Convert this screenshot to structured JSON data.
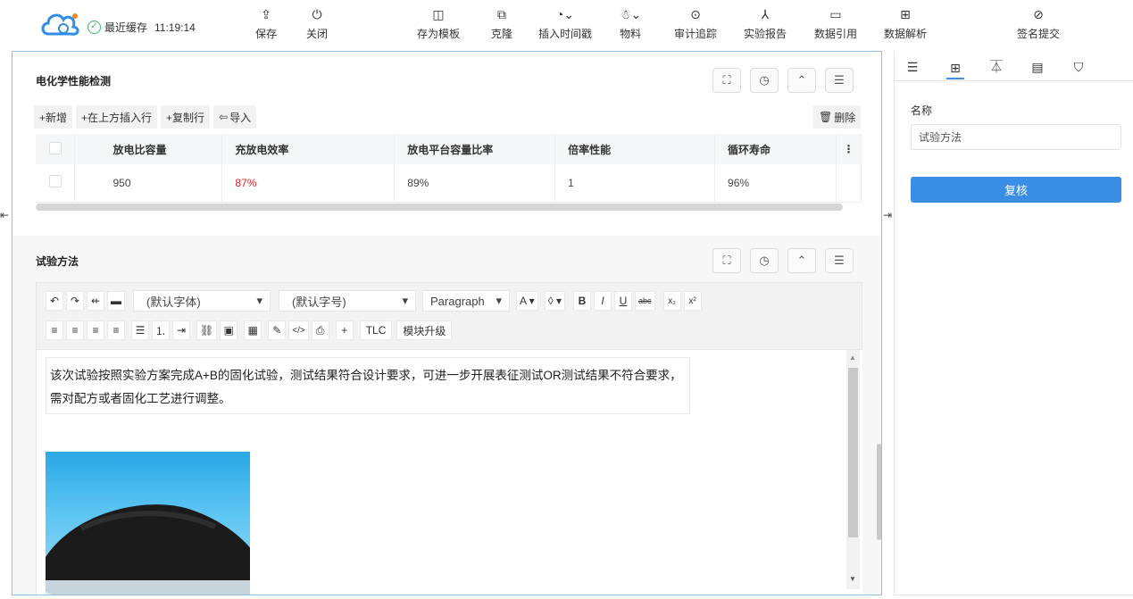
{
  "topbar": {
    "saved_text": "最近缓存",
    "saved_time": "11:19:14",
    "tools": [
      {
        "label": "保存",
        "icon": "save-icon"
      },
      {
        "label": "关闭",
        "icon": "power-icon"
      },
      {
        "label": "存为模板",
        "icon": "template-icon"
      },
      {
        "label": "克隆",
        "icon": "clone-icon"
      },
      {
        "label": "插入时间戳",
        "icon": "clock-icon"
      },
      {
        "label": "物料",
        "icon": "material-icon"
      },
      {
        "label": "审计追踪",
        "icon": "audit-icon"
      },
      {
        "label": "实验报告",
        "icon": "report-icon"
      },
      {
        "label": "数据引用",
        "icon": "data-ref-icon"
      },
      {
        "label": "数据解析",
        "icon": "data-parse-icon"
      },
      {
        "label": "签名提交",
        "icon": "sign-icon"
      }
    ]
  },
  "section1": {
    "title": "电化学性能检测",
    "buttons": {
      "add": "+新增",
      "insert_above": "+在上方插入行",
      "copy_row": "+复制行",
      "import": "导入",
      "delete": "删除"
    },
    "columns": [
      "放电比容量",
      "充放电效率",
      "放电平台容量比率",
      "倍率性能",
      "循环寿命"
    ],
    "rows": [
      [
        "950",
        "87%",
        "89%",
        "1",
        "96%"
      ]
    ],
    "highlight_color": "#e02020"
  },
  "section2": {
    "title": "试验方法",
    "font_select": "(默认字体)",
    "size_select": "(默认字号)",
    "para_select": "Paragraph",
    "tlc_button": "TLC",
    "upgrade_button": "模块升级",
    "content": "该次试验按照实验方案完成A+B的固化试验，测试结果符合设计要求，可进一步开展表征测试OR测试结果不符合要求，需对配方或者固化工艺进行调整。"
  },
  "right_panel": {
    "name_label": "名称",
    "name_value": "试验方法",
    "review_button": "复核",
    "accent": "#3a8ee6"
  }
}
